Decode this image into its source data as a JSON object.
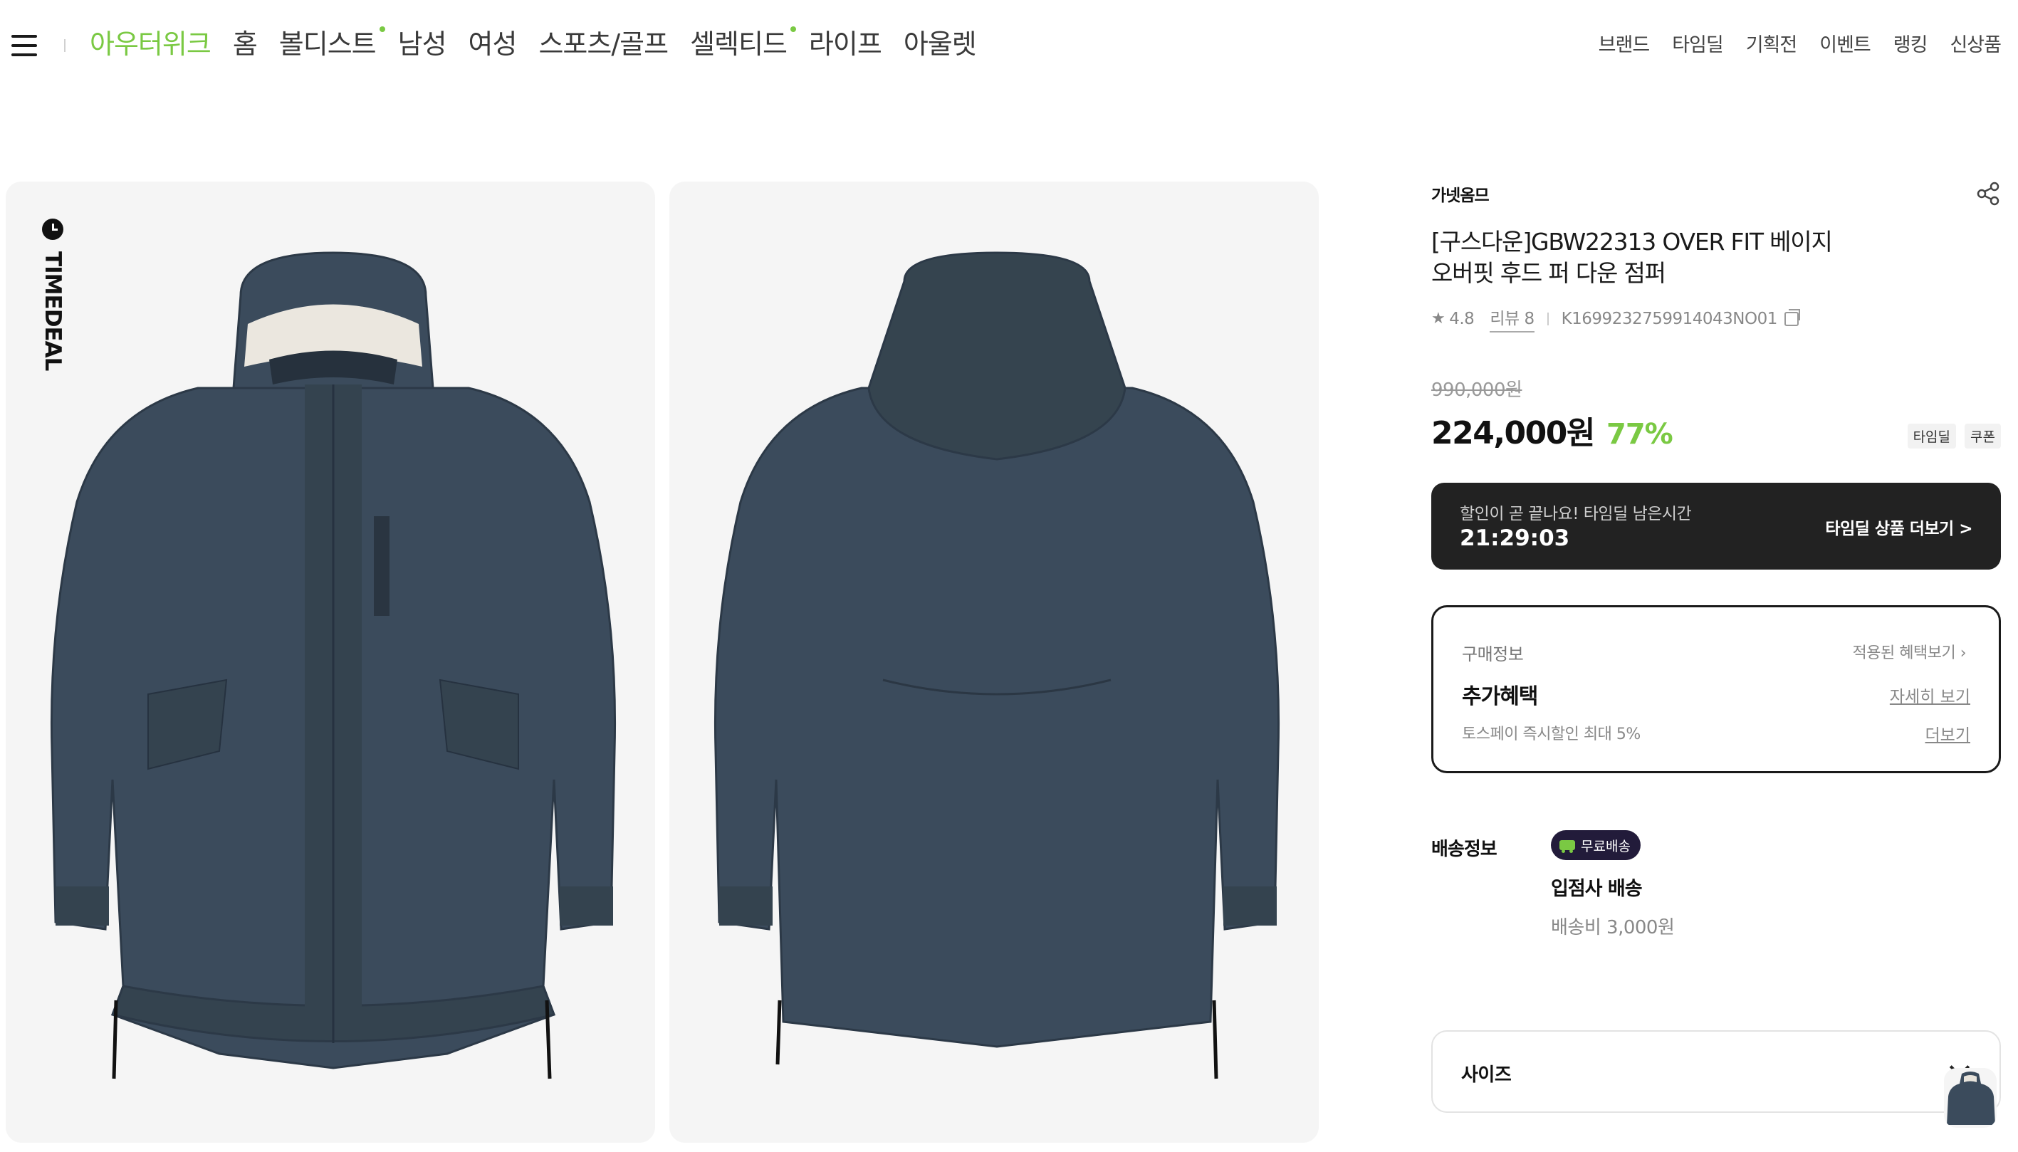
{
  "header": {
    "gnb": [
      {
        "label": "아우터위크",
        "active": true
      },
      {
        "label": "홈"
      },
      {
        "label": "볼디스트",
        "dot": true
      },
      {
        "label": "남성"
      },
      {
        "label": "여성"
      },
      {
        "label": "스포츠/골프"
      },
      {
        "label": "셀렉티드",
        "dot": true
      },
      {
        "label": "라이프"
      },
      {
        "label": "아울렛"
      }
    ],
    "util": [
      "브랜드",
      "타임딜",
      "기획전",
      "이벤트",
      "랭킹",
      "신상품"
    ]
  },
  "gallery": {
    "badge_text": "TIMEDEAL",
    "jacket_color": "#3b4b5c"
  },
  "product": {
    "brand": "가넷옴므",
    "title_line1": "[구스다운]GBW22313 OVER FIT 베이지",
    "title_line2": "오버핏 후드 퍼 다운 점퍼",
    "rating": "4.8",
    "review": "리뷰 8",
    "code": "K1699232759914043NO01",
    "original_price": "990,000원",
    "price": "224,000원",
    "discount": "77%",
    "badges": [
      "타임딜",
      "쿠폰"
    ]
  },
  "timedeal": {
    "message": "할인이 곧 끝나요! 타임딜 남은시간",
    "timer": "21:29:03",
    "more": "타임딜 상품 더보기 >"
  },
  "purchase": {
    "label": "구매정보",
    "applied": "적용된 혜택보기 ›",
    "extra": "추가혜택",
    "detail": "자세히 보기",
    "toss": "토스페이 즉시할인 최대 5%",
    "more": "더보기"
  },
  "shipping": {
    "label": "배송정보",
    "free_badge": "무료배송",
    "partner": "입점사 배송",
    "fee": "배송비 3,000원"
  },
  "size": {
    "label": "사이즈"
  },
  "colors": {
    "accent": "#7ac943",
    "dark_box": "#222222"
  }
}
